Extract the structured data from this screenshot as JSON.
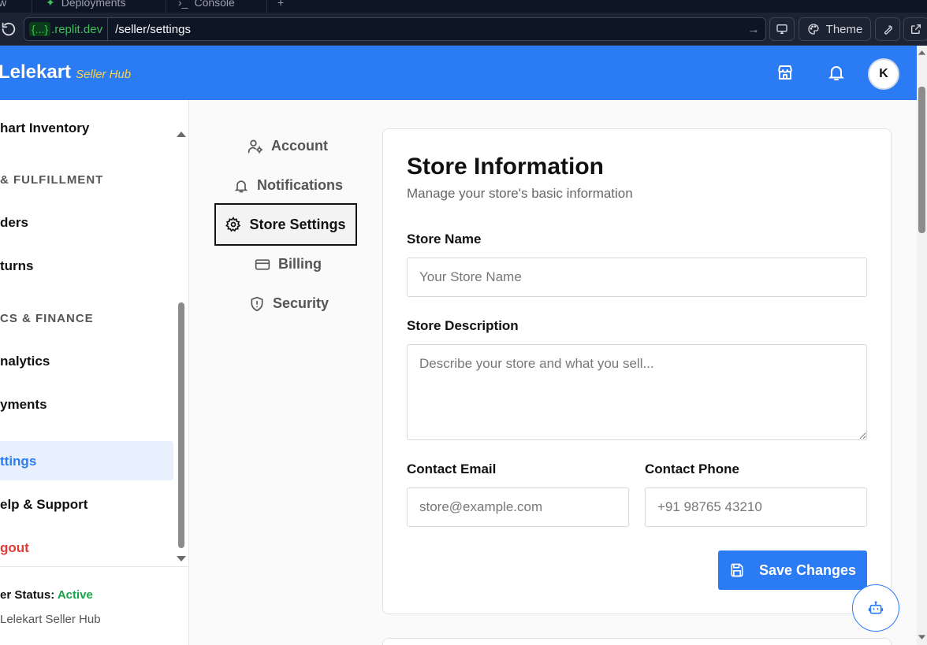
{
  "browser": {
    "tabs": [
      {
        "label": "w"
      },
      {
        "label": "Deployments"
      },
      {
        "label": "Console"
      }
    ],
    "url_host_prefix": "{...}",
    "url_host": ".replit.dev",
    "url_path": "/seller/settings",
    "theme_label": "Theme"
  },
  "header": {
    "brand": "Lelekart",
    "brand_sub": "Seller Hub",
    "avatar_initial": "K"
  },
  "sidebar": {
    "items": [
      {
        "label": "hart Inventory"
      },
      {
        "label": "ders"
      },
      {
        "label": "turns"
      },
      {
        "label": "nalytics"
      },
      {
        "label": "yments"
      },
      {
        "label": "ttings"
      },
      {
        "label": "elp & Support"
      },
      {
        "label": "gout"
      }
    ],
    "sections": [
      {
        "label": "& FULFILLMENT"
      },
      {
        "label": "CS & FINANCE"
      }
    ],
    "status_label": "er Status:",
    "status_value": "Active",
    "copyright": "Lelekart Seller Hub"
  },
  "settings_nav": {
    "items": [
      {
        "label": "Account"
      },
      {
        "label": "Notifications"
      },
      {
        "label": "Store Settings"
      },
      {
        "label": "Billing"
      },
      {
        "label": "Security"
      }
    ]
  },
  "store_form": {
    "title": "Store Information",
    "subtitle": "Manage your store's basic information",
    "store_name_label": "Store Name",
    "store_name_placeholder": "Your Store Name",
    "description_label": "Store Description",
    "description_placeholder": "Describe your store and what you sell...",
    "email_label": "Contact Email",
    "email_placeholder": "store@example.com",
    "phone_label": "Contact Phone",
    "phone_placeholder": "+91 98765 43210",
    "save_label": "Save Changes"
  },
  "colors": {
    "brand_blue": "#2b7bf5",
    "brand_yellow": "#fbd44a",
    "status_green": "#17a34a",
    "logout_red": "#e53935",
    "active_bg": "#e8f0fe"
  }
}
